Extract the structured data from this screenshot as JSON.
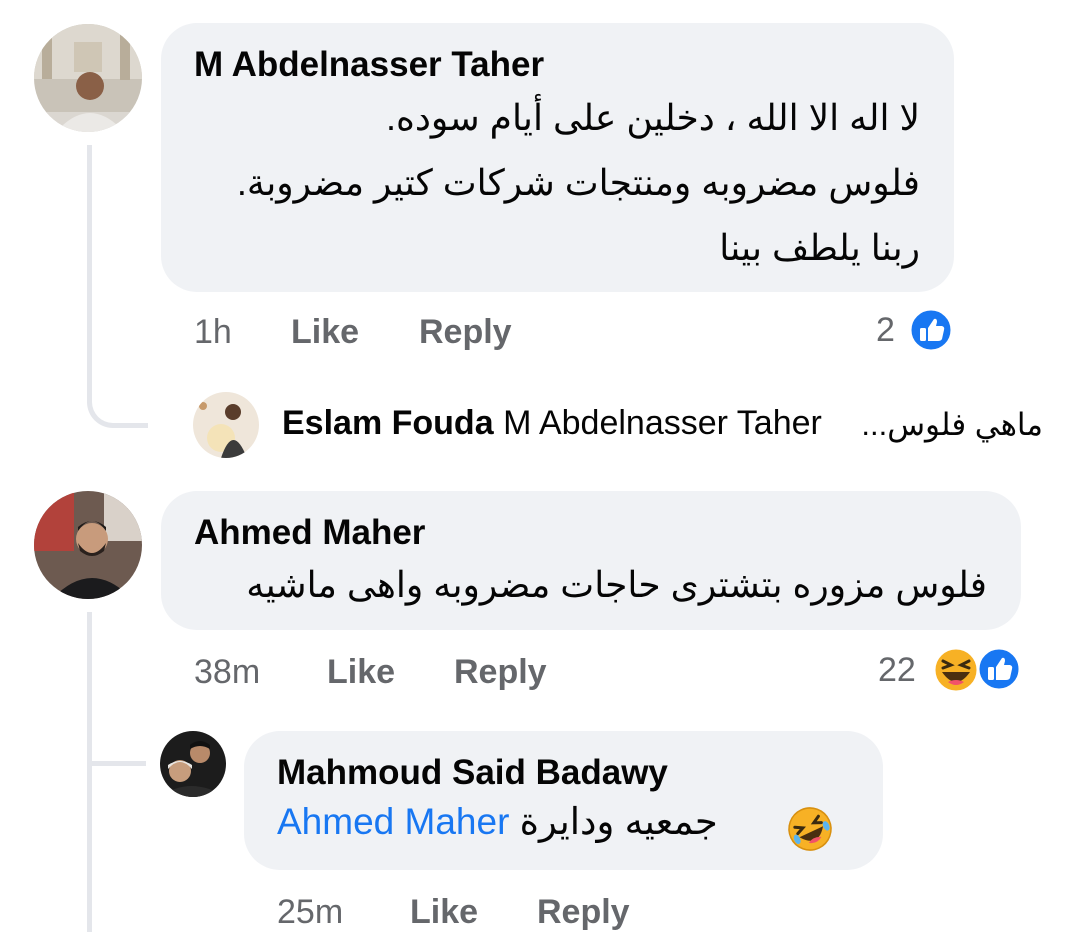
{
  "comments": [
    {
      "author": "M Abdelnasser Taher",
      "lines": [
        "لا اله الا الله ، دخلين على أيام سوده.",
        "فلوس مضروبه ومنتجات شركات كتير مضروبة.",
        "ربنا يلطف بينا"
      ],
      "time": "1h",
      "like_label": "Like",
      "reply_label": "Reply",
      "reaction_count": "2",
      "reactions": [
        "like-icon"
      ],
      "reply_preview": {
        "author": "Eslam Fouda",
        "mention": "M Abdelnasser Taher",
        "text": "ماهي فلوس..."
      }
    },
    {
      "author": "Ahmed Maher",
      "lines": [
        "فلوس مزوره بتشترى حاجات مضروبه واهى ماشيه"
      ],
      "time": "38m",
      "like_label": "Like",
      "reply_label": "Reply",
      "reaction_count": "22",
      "reactions": [
        "haha-icon",
        "like-icon"
      ],
      "replies": [
        {
          "author": "Mahmoud Said Badawy",
          "mention": "Ahmed Maher",
          "text": "جمعيه ودايرة",
          "emoji": "rolling-on-floor-laughing-icon",
          "time": "25m",
          "like_label": "Like",
          "reply_label": "Reply"
        }
      ]
    }
  ],
  "colors": {
    "bubble": "#f0f2f5",
    "meta": "#65676b",
    "link": "#1877f2",
    "thread_line": "#e4e6eb",
    "like_blue": "#1877f2",
    "haha_yellow": "#f7b125"
  }
}
